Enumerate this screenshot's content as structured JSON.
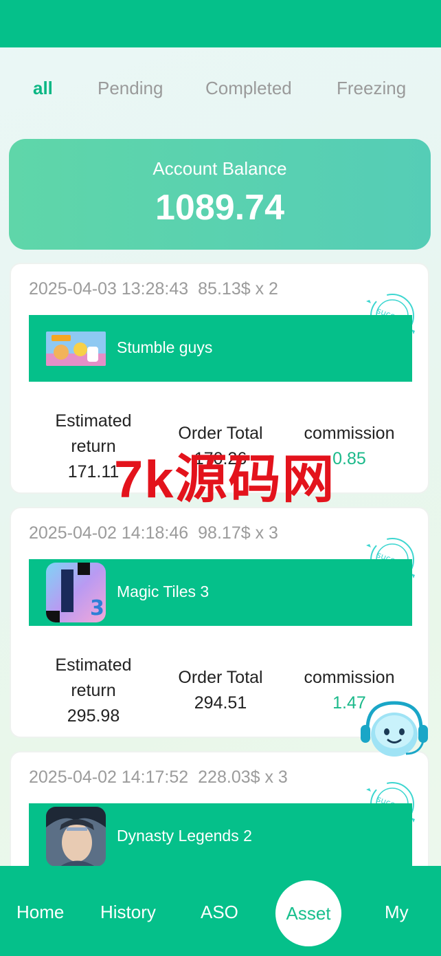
{
  "tabs": [
    "all",
    "Pending",
    "Completed",
    "Freezing"
  ],
  "balance": {
    "label": "Account Balance",
    "amount": "1089.74"
  },
  "orders": [
    {
      "datetime": "2025-04-03 13:28:43",
      "price": "85.13$ x 2",
      "game": "Stumble guys",
      "estimated_label": "Estimated return",
      "estimated": "171.11",
      "total_label": "Order Total",
      "total": "170.26",
      "commission_label": "commission",
      "commission": "0.85"
    },
    {
      "datetime": "2025-04-02 14:18:46",
      "price": "98.17$ x 3",
      "game": "Magic Tiles 3",
      "estimated_label": "Estimated return",
      "estimated": "295.98",
      "total_label": "Order Total",
      "total": "294.51",
      "commission_label": "commission",
      "commission": "1.47"
    },
    {
      "datetime": "2025-04-02 14:17:52",
      "price": "228.03$ x 3",
      "game": "Dynasty Legends 2"
    }
  ],
  "stamp_text": "success",
  "watermark": "7k源码网",
  "nav": {
    "home": "Home",
    "history": "History",
    "aso": "ASO",
    "asset": "Asset",
    "my": "My"
  },
  "colors": {
    "primary": "#05c08a",
    "active_tab": "#0bb784",
    "commission": "#1bb98a",
    "watermark": "#e3131c"
  },
  "icons": [
    "stumble-guys-icon",
    "magic-tiles-icon",
    "dynasty-legends-icon",
    "success-stamp-icon",
    "support-bot-icon"
  ]
}
